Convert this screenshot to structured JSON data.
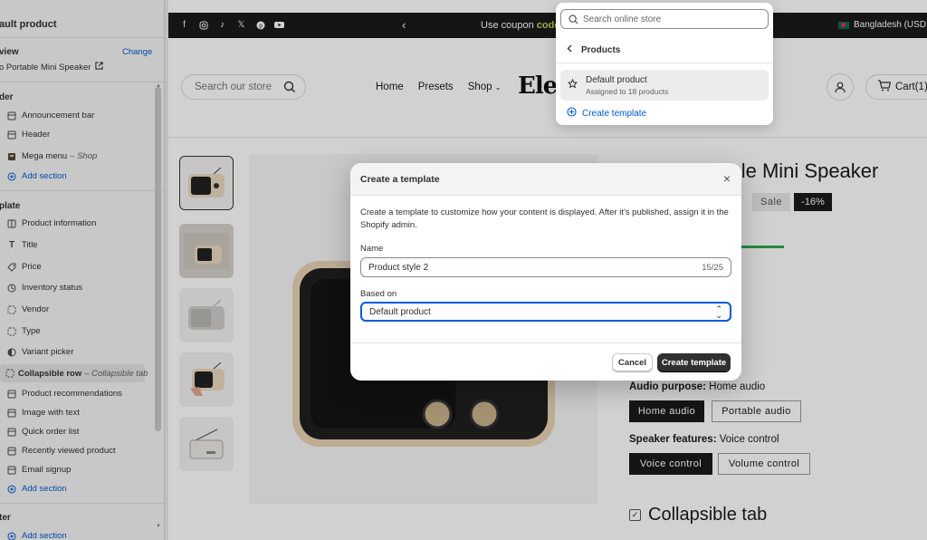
{
  "sidebar": {
    "title": "ault product",
    "preview_label": "view",
    "change_link": "Change",
    "preview_value": "o Portable Mini Speaker",
    "header_group": "der",
    "header_items": [
      {
        "label": "Announcement bar",
        "icon": "layout-icon"
      },
      {
        "label": "Header",
        "icon": "layout-icon"
      },
      {
        "label": "Mega menu",
        "suffix": "– Shop",
        "icon": "mega-menu-icon"
      }
    ],
    "add_section": "Add section",
    "template_group": "plate",
    "template_items": [
      {
        "label": "Product information",
        "icon": "layout-icon"
      },
      {
        "label": "Title",
        "icon": "text-icon"
      },
      {
        "label": "Price",
        "icon": "price-icon"
      },
      {
        "label": "Inventory status",
        "icon": "inventory-icon"
      },
      {
        "label": "Vendor",
        "icon": "dashed-box-icon"
      },
      {
        "label": "Type",
        "icon": "dashed-box-icon"
      },
      {
        "label": "Variant picker",
        "icon": "variant-icon"
      },
      {
        "label": "Collapsible row",
        "suffix": "– Collapsible tab",
        "icon": "dashed-box-icon"
      },
      {
        "label": "Product recommendations",
        "icon": "layout-icon"
      },
      {
        "label": "Image with text",
        "icon": "layout-icon"
      },
      {
        "label": "Quick order list",
        "icon": "layout-icon"
      },
      {
        "label": "Recently viewed product",
        "icon": "layout-icon"
      },
      {
        "label": "Email signup",
        "icon": "layout-icon"
      }
    ],
    "footer_group": "ter"
  },
  "store": {
    "coupon_prefix": "Use coupon ",
    "coupon_code": "code",
    "country": "Bangladesh (USD $",
    "search_placeholder": "Search our store",
    "nav": [
      "Home",
      "Presets",
      "Shop"
    ],
    "logo": "Ele",
    "cart": "Cart(1)",
    "product_title": "Retro Portable Mini Speaker",
    "sale": "Sale",
    "discount": "-16%",
    "audio_label": "Audio purpose:",
    "audio_value": "Home audio",
    "audio_options": [
      "Home audio",
      "Portable audio"
    ],
    "feature_label": "Speaker features:",
    "feature_value": "Voice control",
    "feature_options": [
      "Voice control",
      "Volume control"
    ],
    "collapsible_tab": "Collapsible tab"
  },
  "dropdown": {
    "search_placeholder": "Search online store",
    "back_label": "Products",
    "item_name": "Default product",
    "item_sub": "Assigned to 18 products",
    "create_link": "Create template"
  },
  "modal": {
    "title": "Create a template",
    "description": "Create a template to customize how your content is displayed. After it's published, assign it in the Shopify admin.",
    "name_label": "Name",
    "name_value": "Product style 2",
    "name_count": "15/25",
    "based_on_label": "Based on",
    "based_on_value": "Default product",
    "cancel": "Cancel",
    "create": "Create template"
  },
  "colors": {
    "accent": "#005bd3",
    "primary_button": "#303030",
    "coupon_highlight": "#c9d24a",
    "progress": "#2fa84f"
  }
}
